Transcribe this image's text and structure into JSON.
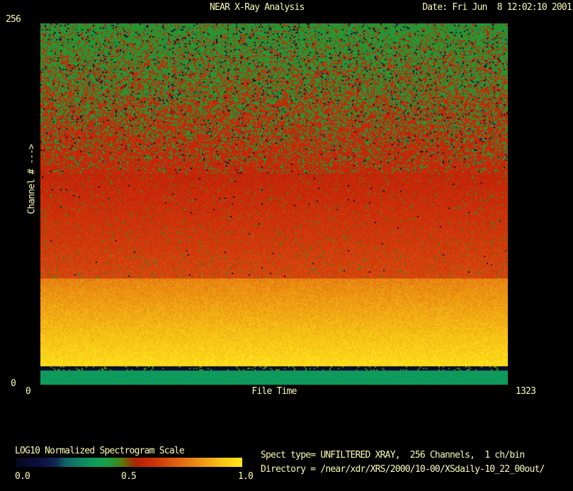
{
  "header": {
    "title": "NEAR X-Ray Analysis",
    "date": "Date: Fri Jun  8 12:02:10 2001"
  },
  "plot": {
    "y_max": "256",
    "y_min": "0",
    "x_min": "0",
    "x_max": "1323",
    "x_label": "File Time",
    "y_label": "Channel # --->"
  },
  "colorbar": {
    "label": "LOG10 Normalized Spectrogram Scale",
    "ticks": [
      "0.0",
      "0.5",
      "1.0"
    ]
  },
  "info": {
    "spect_type": "Spect type= UNFILTERED XRAY,  256 Channels,  1 ch/bin",
    "directory": "Directory = /near/xdr/XRS/2000/10-00/XSdaily-10_22_00out/"
  },
  "colors": {
    "background": "#000000",
    "text": "#fafab4"
  },
  "chart_data": {
    "type": "heatmap",
    "title": "NEAR X-Ray Analysis",
    "xlabel": "File Time",
    "ylabel": "Channel #",
    "x_range": [
      0,
      1323
    ],
    "y_range": [
      0,
      256
    ],
    "scale_label": "LOG10 Normalized Spectrogram Scale",
    "scale_range": [
      0.0,
      1.0
    ],
    "legend_position": "bottom-left colorbar",
    "grid": false,
    "colormap_stops": [
      [
        0.0,
        "#06081c"
      ],
      [
        0.06,
        "#0a0c30"
      ],
      [
        0.12,
        "#0d1242"
      ],
      [
        0.18,
        "#0f2a56"
      ],
      [
        0.22,
        "#116464"
      ],
      [
        0.28,
        "#0f8060"
      ],
      [
        0.34,
        "#0e9a5e"
      ],
      [
        0.4,
        "#18a046"
      ],
      [
        0.44,
        "#2d8f2a"
      ],
      [
        0.47,
        "#5a7a10"
      ],
      [
        0.5,
        "#8a4a06"
      ],
      [
        0.53,
        "#ab2408"
      ],
      [
        0.57,
        "#c52608"
      ],
      [
        0.63,
        "#d03b0c"
      ],
      [
        0.7,
        "#dd5c10"
      ],
      [
        0.8,
        "#ea8d12"
      ],
      [
        0.9,
        "#f6bf16"
      ],
      [
        1.0,
        "#ffe81c"
      ]
    ],
    "bands": [
      {
        "channels": [
          0,
          10
        ],
        "kind": "uniform",
        "value": 0.345,
        "noise": 0.012,
        "desc": "solid sea-green strip along bottom (channels 0-10)"
      },
      {
        "channels": [
          10,
          12.5
        ],
        "kind": "uniform",
        "value": 0.05,
        "noise": 0.04,
        "speck_p": 0.12,
        "speck_v": 0.46,
        "desc": "thin dark gap line with olive specks (~channel 11)"
      },
      {
        "channels": [
          12.5,
          75
        ],
        "kind": "gradient",
        "v_lo": 0.97,
        "v_hi": 0.78,
        "noise": 0.045,
        "desc": "bright yellow-orange band, brightest at lowest channels"
      },
      {
        "channels": [
          75,
          150
        ],
        "kind": "gradient",
        "v_lo": 0.655,
        "v_hi": 0.565,
        "noise": 0.03,
        "speck_p": 0.035,
        "speck_v": 0.46,
        "dark_p": 0.004,
        "desc": "strong red zone with sparse olive-green specks"
      },
      {
        "channels": [
          150,
          256
        ],
        "kind": "mixture",
        "red_v": 0.575,
        "green_v": 0.43,
        "red_noise": 0.03,
        "green_noise": 0.035,
        "p_red_lo": 0.87,
        "p_red_hi": 0.1,
        "dark_p_lo": 0.012,
        "dark_p_hi": 0.075,
        "desc": "noisy red-to-green transition; mostly green with sparse dark-navy and red speckles at high channels"
      }
    ],
    "render_seed": 42
  }
}
